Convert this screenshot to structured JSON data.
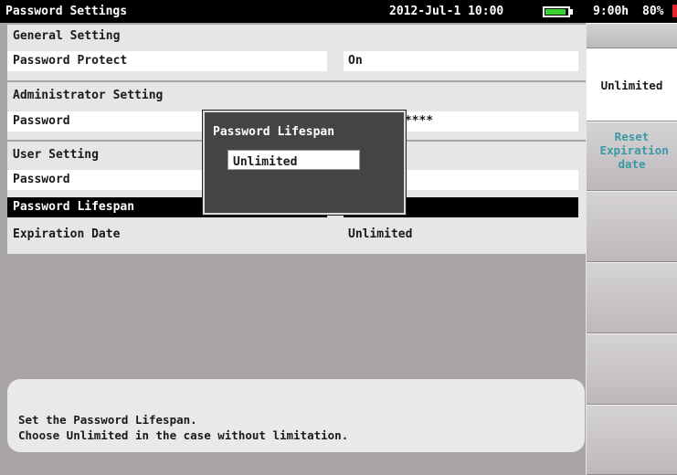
{
  "header": {
    "title": "Password Settings",
    "datetime": "2012-Jul-1 10:00",
    "battery_icon": "battery-icon",
    "battery_level": 0.9,
    "runtime": "9:00h",
    "battery_percent": "80%",
    "power_icon": "ac-plug-icon"
  },
  "general": {
    "heading": "General Setting",
    "password_protect_label": "Password Protect",
    "password_protect_value": "On"
  },
  "admin": {
    "heading": "Administrator Setting",
    "password_label": "Password",
    "password_value": "*****"
  },
  "user": {
    "heading": "User Setting",
    "password_label": "Password",
    "lifespan_label": "Password Lifespan",
    "expiration_label": "Expiration Date",
    "expiration_value": "Unlimited"
  },
  "popup": {
    "title": "Password Lifespan",
    "value": "Unlimited"
  },
  "help": {
    "line1": "Set the Password Lifespan.",
    "line2": "Choose Unlimited in the case without limitation."
  },
  "fkeys": {
    "f1": "",
    "f2": "Unlimited",
    "f3": "Reset Expiration date",
    "f4": "",
    "f5": "",
    "f6": ""
  },
  "colors": {
    "accent_teal": "#3a9aa6",
    "battery_green": "#38d330",
    "selection": "#000000"
  }
}
